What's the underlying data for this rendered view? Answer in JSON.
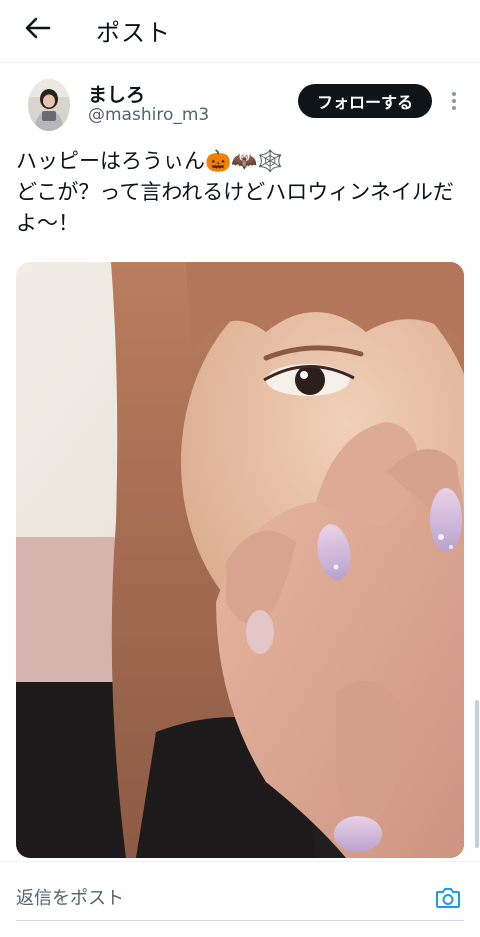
{
  "header": {
    "back_icon": "arrow-left-icon",
    "title": "ポスト"
  },
  "author": {
    "display_name": "ましろ",
    "handle": "@mashiro_m3",
    "follow_label": "フォローする",
    "more_icon": "vertical-dots-icon"
  },
  "tweet": {
    "text": "ハッピーはろうぃん🎃🦇🕸️\nどこが？って言われるけどハロウィンネイルだよ〜！",
    "media_type": "photo"
  },
  "reply": {
    "placeholder": "返信をポスト",
    "camera_icon": "camera-icon"
  },
  "colors": {
    "primary_text": "#0f1419",
    "secondary_text": "#536471",
    "follow_button_bg": "#0f1419",
    "accent": "#1d9bf0",
    "divider": "#eff3f4"
  }
}
